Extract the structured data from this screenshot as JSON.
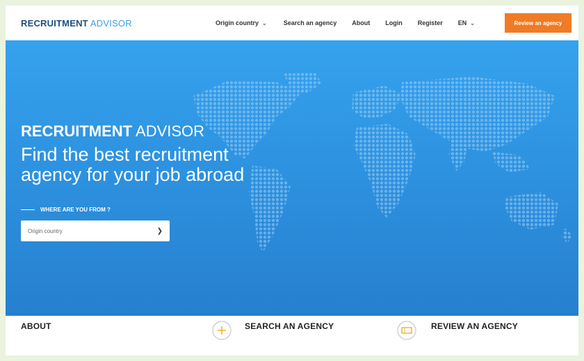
{
  "brand": {
    "bold": "RECRUITMENT",
    "light": "ADVISOR"
  },
  "nav": {
    "items": [
      {
        "label": "Origin country",
        "has_dropdown": true
      },
      {
        "label": "Search an agency",
        "has_dropdown": false
      },
      {
        "label": "About",
        "has_dropdown": false
      },
      {
        "label": "Login",
        "has_dropdown": false
      },
      {
        "label": "Register",
        "has_dropdown": false
      },
      {
        "label": "EN",
        "has_dropdown": true
      }
    ],
    "cta_label": "Review an agency",
    "cta_color": "#f07b25"
  },
  "hero": {
    "brand_bold": "RECRUITMENT",
    "brand_light": "ADVISOR",
    "headline": "Find the best recruitment agency for your job abroad",
    "where_label": "WHERE ARE YOU FROM ?",
    "select_value": "Origin country",
    "background_color": "#2f93e2"
  },
  "sections": {
    "about": "ABOUT",
    "search": "SEARCH AN AGENCY",
    "review": "REVIEW AN AGENCY"
  },
  "icons": {
    "search_section_icon": "plus-circle-icon",
    "review_section_icon": "ticket-icon",
    "dropdown_icon": "chevron-down-icon"
  }
}
